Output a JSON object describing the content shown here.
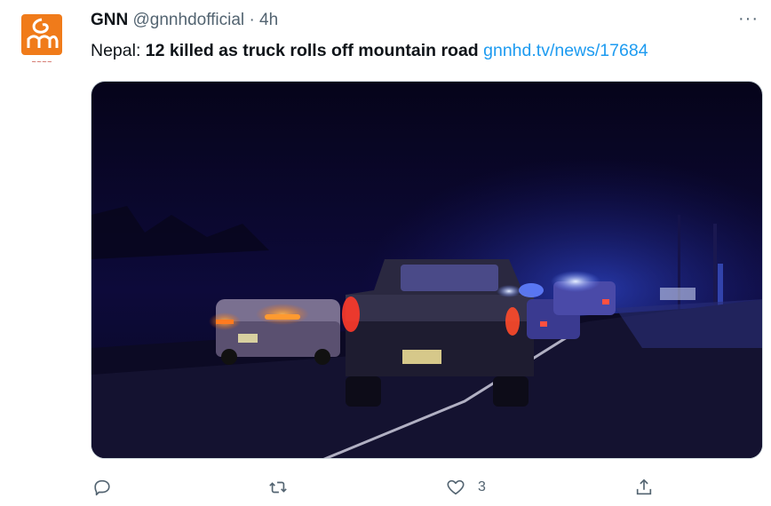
{
  "tweet": {
    "author_name": "GNN",
    "handle": "@gnnhdofficial",
    "separator": "·",
    "time": "4h",
    "more_label": "···",
    "text_prefix": "Nepal: ",
    "text_bold": "12 killed as truck rolls off mountain road",
    "link": "gnnhd.tv/news/17684"
  },
  "avatar": {
    "logo_text": "GNN",
    "brand_color": "#f07b1a"
  },
  "media": {
    "kind": "night-road-police-scene"
  },
  "actions": {
    "reply": {
      "icon": "reply-icon"
    },
    "retweet": {
      "icon": "retweet-icon"
    },
    "like": {
      "icon": "heart-icon",
      "count": "3"
    },
    "share": {
      "icon": "share-icon"
    }
  },
  "colors": {
    "link": "#1d9bf0",
    "secondary_text": "#536471"
  }
}
